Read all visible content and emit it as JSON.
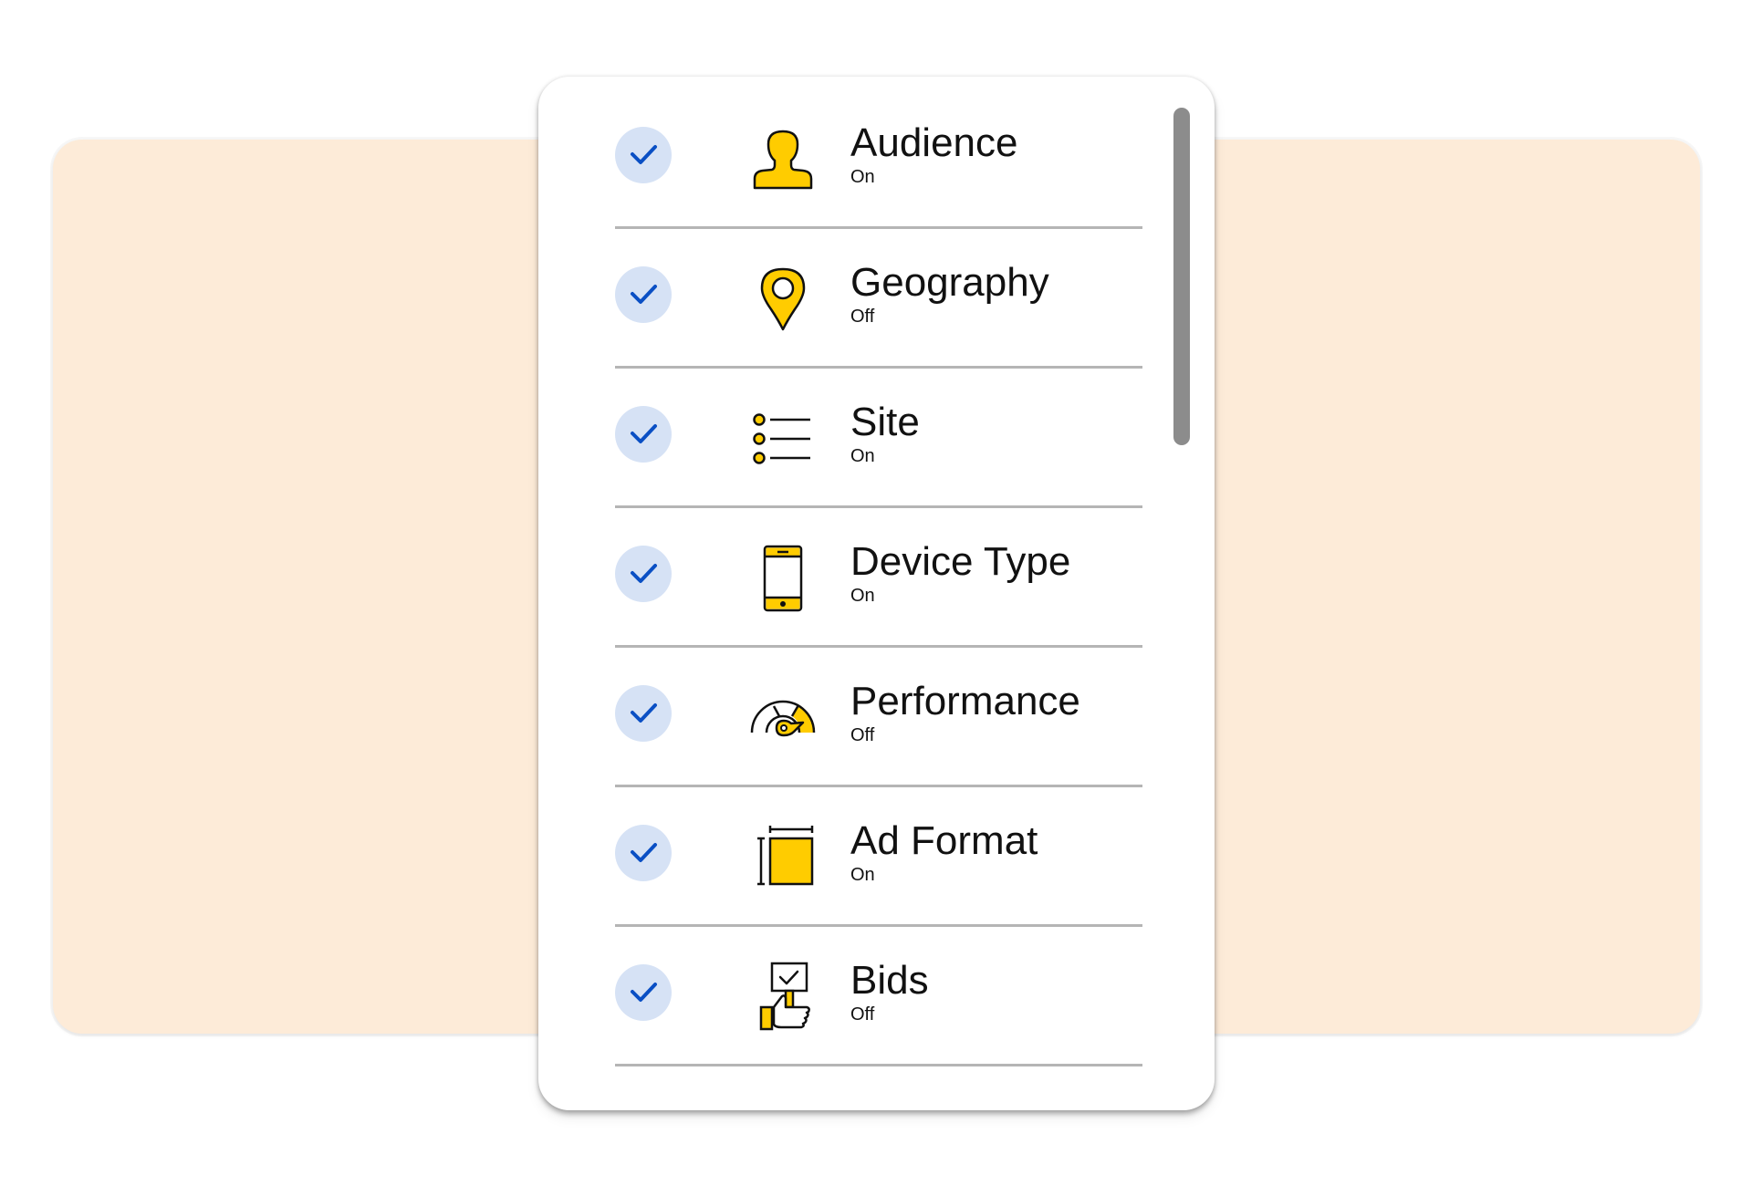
{
  "colors": {
    "backdrop": "#fdebd8",
    "card": "#ffffff",
    "check_bg": "#d6e2f5",
    "check_mark": "#0a4fc4",
    "icon_fill": "#ffcc00",
    "icon_stroke": "#111111",
    "divider": "#b5b5b5",
    "scrollbar": "#8c8c8c"
  },
  "items": [
    {
      "title": "Audience",
      "status": "On",
      "checked": true,
      "icon": "person-icon"
    },
    {
      "title": "Geography",
      "status": "Off",
      "checked": true,
      "icon": "map-pin-icon"
    },
    {
      "title": "Site",
      "status": "On",
      "checked": true,
      "icon": "list-icon"
    },
    {
      "title": "Device Type",
      "status": "On",
      "checked": true,
      "icon": "mobile-phone-icon"
    },
    {
      "title": "Performance",
      "status": "Off",
      "checked": true,
      "icon": "speedometer-icon"
    },
    {
      "title": "Ad Format",
      "status": "On",
      "checked": true,
      "icon": "ad-size-icon"
    },
    {
      "title": "Bids",
      "status": "Off",
      "checked": true,
      "icon": "hand-holding-sign-icon"
    }
  ]
}
